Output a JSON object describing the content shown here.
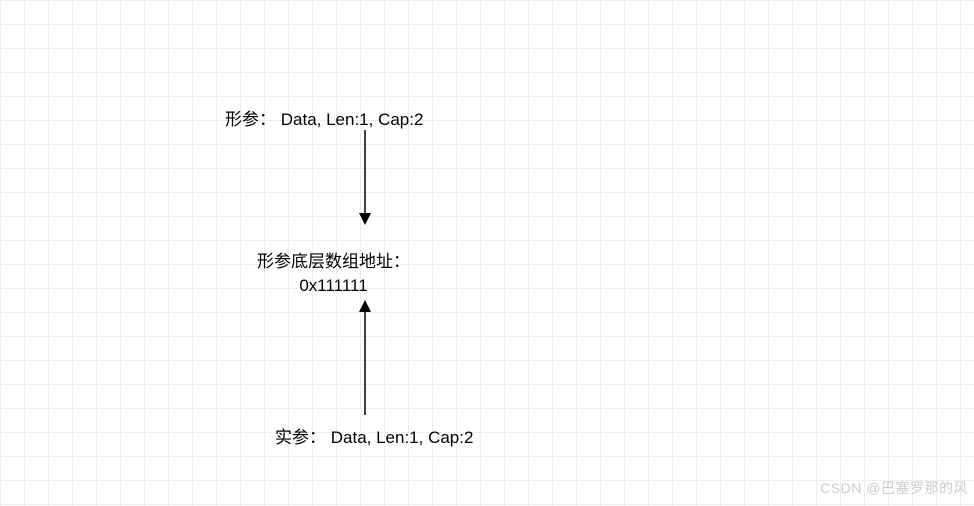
{
  "diagram": {
    "topBox": {
      "prefix": "形参：",
      "values": "Data, Len:1, Cap:2"
    },
    "middleBox": {
      "line1": "形参底层数组地址：",
      "line2": "0x111111"
    },
    "bottomBox": {
      "prefix": "实参：",
      "values": "Data, Len:1, Cap:2"
    }
  },
  "watermark": "CSDN @巴塞罗那的风"
}
